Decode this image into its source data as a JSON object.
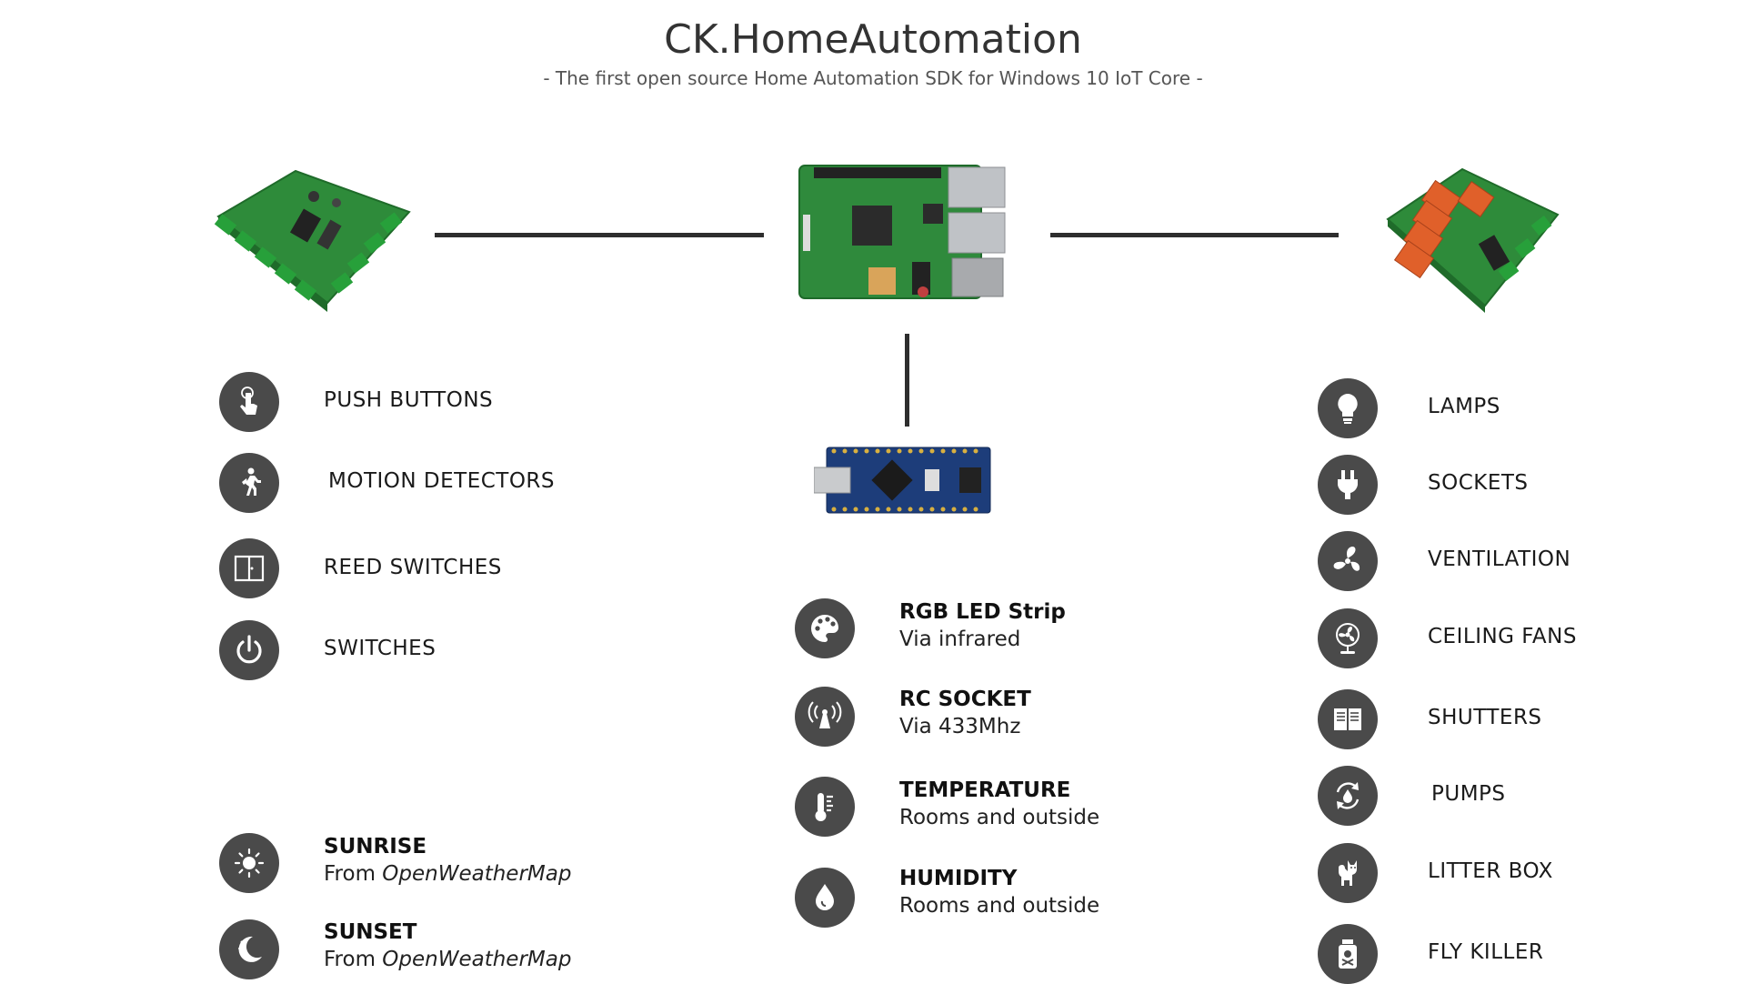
{
  "header": {
    "title": "CK.HomeAutomation",
    "subtitle": "- The first open source Home Automation SDK for Windows 10 IoT Core -"
  },
  "inputs": [
    {
      "label": "PUSH BUTTONS",
      "icon": "touch-icon"
    },
    {
      "label": "MOTION DETECTORS",
      "icon": "walking-person-icon"
    },
    {
      "label": "REED SWITCHES",
      "icon": "door-icon"
    },
    {
      "label": "SWITCHES",
      "icon": "power-icon"
    }
  ],
  "weather": [
    {
      "title": "SUNRISE",
      "prefix": "From ",
      "source": "OpenWeatherMap",
      "icon": "sun-icon"
    },
    {
      "title": "SUNSET",
      "prefix": "From ",
      "source": "OpenWeatherMap",
      "icon": "moon-icon"
    }
  ],
  "middle": [
    {
      "title": "RGB LED Strip",
      "sub": "Via infrared",
      "icon": "palette-icon"
    },
    {
      "title": "RC SOCKET",
      "sub": "Via 433Mhz",
      "icon": "antenna-icon"
    },
    {
      "title": "TEMPERATURE",
      "sub": "Rooms and outside",
      "icon": "thermometer-icon"
    },
    {
      "title": "HUMIDITY",
      "sub": "Rooms and outside",
      "icon": "drop-icon"
    }
  ],
  "outputs": [
    {
      "label": "LAMPS",
      "icon": "bulb-icon"
    },
    {
      "label": "SOCKETS",
      "icon": "plug-icon"
    },
    {
      "label": "VENTILATION",
      "icon": "fan-icon"
    },
    {
      "label": "CEILING FANS",
      "icon": "desk-fan-icon"
    },
    {
      "label": "SHUTTERS",
      "icon": "window-icon"
    },
    {
      "label": "PUMPS",
      "icon": "cycle-icon"
    },
    {
      "label": "LITTER BOX",
      "icon": "cat-icon"
    },
    {
      "label": "FLY KILLER",
      "icon": "poison-icon"
    }
  ],
  "colors": {
    "icon_circle": "#4a4a4a",
    "connector_line": "#2e2e2e",
    "pcb_green": "#2e8b3a",
    "relay_orange": "#e0602a",
    "arduino_blue": "#1d3d7a"
  }
}
